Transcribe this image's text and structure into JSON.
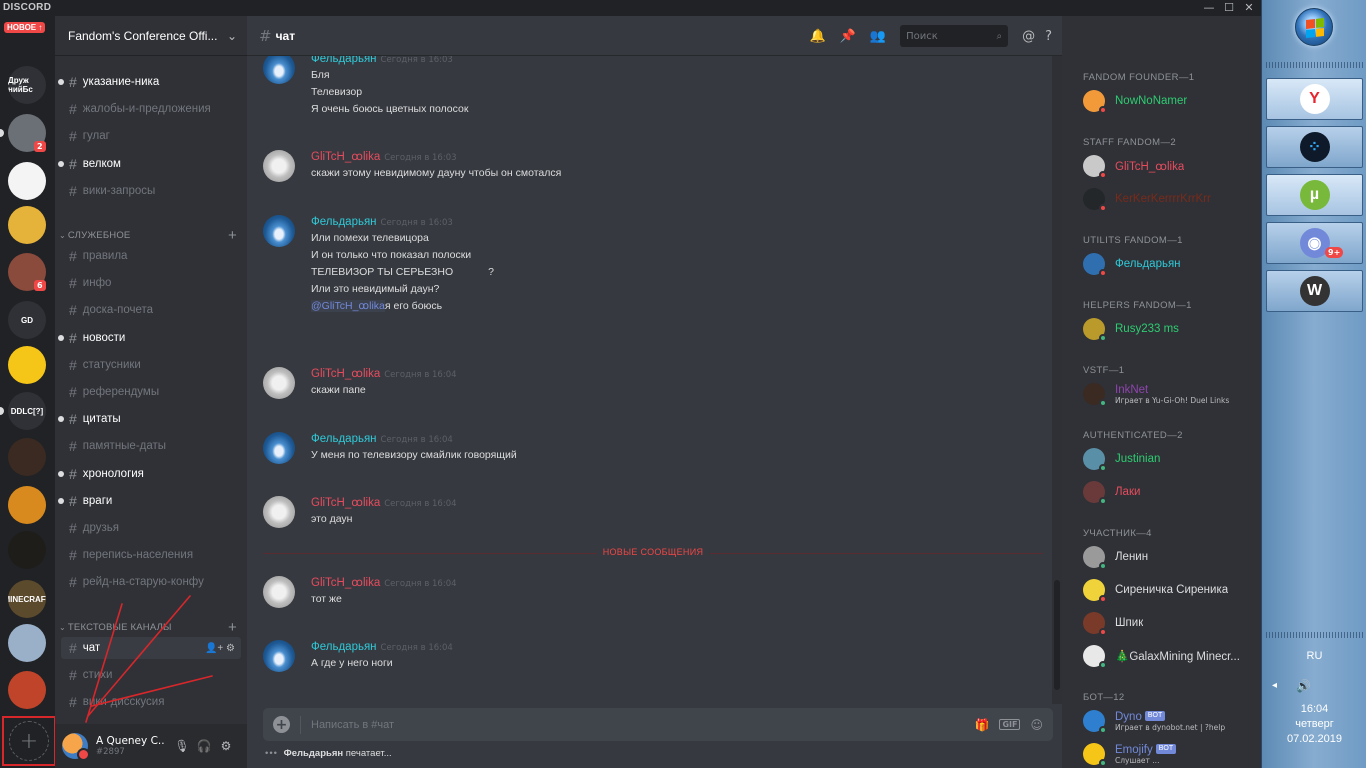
{
  "app": {
    "brand": "DISCORD",
    "window_controls": [
      "—",
      "☐",
      "✕"
    ]
  },
  "servers": {
    "new_badge": "НОВОЕ ↑",
    "items": [
      {
        "label": "Друж нийБс",
        "bg": "#2f3136",
        "badge": ""
      },
      {
        "label": "",
        "bg": "#6b6f76",
        "badge": "2"
      },
      {
        "label": "",
        "bg": "#f4f4f4",
        "badge": ""
      },
      {
        "label": "",
        "bg": "#e6b33a",
        "badge": ""
      },
      {
        "label": "",
        "bg": "#8a4a3c",
        "badge": "6"
      },
      {
        "label": "GD",
        "bg": "#2f3136",
        "badge": ""
      },
      {
        "label": "",
        "bg": "#f5c518",
        "badge": ""
      },
      {
        "label": "DDLC[?]",
        "bg": "#2f3136",
        "badge": ""
      },
      {
        "label": "",
        "bg": "#3b2a22",
        "badge": ""
      },
      {
        "label": "",
        "bg": "#d98a1e",
        "badge": ""
      },
      {
        "label": "",
        "bg": "#1e1d1a",
        "badge": ""
      },
      {
        "label": "MINECRAFT",
        "bg": "#5c4a2c",
        "badge": ""
      },
      {
        "label": "",
        "bg": "#9ab0c9",
        "badge": ""
      },
      {
        "label": "",
        "bg": "#c0442a",
        "badge": ""
      }
    ]
  },
  "guild": {
    "name": "Fandom's Conference Offi..."
  },
  "channels": {
    "list1": [
      {
        "name": "указание-ника",
        "unread": true
      },
      {
        "name": "жалобы-и-предложения",
        "unread": false
      },
      {
        "name": "гулаг",
        "unread": false
      },
      {
        "name": "велком",
        "unread": true
      },
      {
        "name": "вики-запросы",
        "unread": false
      }
    ],
    "cat_service": "СЛУЖЕБНОЕ",
    "list2": [
      {
        "name": "правила",
        "unread": false
      },
      {
        "name": "инфо",
        "unread": false
      },
      {
        "name": "доска-почета",
        "unread": false
      },
      {
        "name": "новости",
        "unread": true
      },
      {
        "name": "статусники",
        "unread": false
      },
      {
        "name": "референдумы",
        "unread": false
      },
      {
        "name": "цитаты",
        "unread": true
      },
      {
        "name": "памятные-даты",
        "unread": false
      },
      {
        "name": "хронология",
        "unread": true
      },
      {
        "name": "враги",
        "unread": true
      },
      {
        "name": "друзья",
        "unread": false
      },
      {
        "name": "перепись-населения",
        "unread": false
      },
      {
        "name": "рейд-на-старую-конфу",
        "unread": false
      }
    ],
    "cat_text": "ТЕКСТОВЫЕ КАНАЛЫ",
    "list3": [
      {
        "name": "чат",
        "active": true
      },
      {
        "name": "стихи",
        "active": false
      },
      {
        "name": "вики-дисскусия",
        "active": false
      }
    ]
  },
  "user": {
    "name": "A Queney C...",
    "discriminator": "#2897"
  },
  "chat": {
    "channel": "чат",
    "search_placeholder": "Поиск",
    "composer_placeholder": "Написать в #чат",
    "typing_user": "Фельдарьян",
    "typing_text": "печатает...",
    "new_messages_label": "НОВЫЕ СООБЩЕНИЯ",
    "messages": [
      {
        "author": "Фельдарьян",
        "kind": "f",
        "time": "Сегодня в 16:03",
        "lines": [
          "Бля",
          "Телевизор",
          "Я очень боюсь цветных полосок"
        ]
      },
      {
        "author": "GliTcH_ꝏlika",
        "kind": "g",
        "time": "Сегодня в 16:03",
        "lines": [
          "скажи этому невидимому дауну чтобы он смотался"
        ]
      },
      {
        "author": "Фельдарьян",
        "kind": "f",
        "time": "Сегодня в 16:03",
        "lines": [
          "Или помехи телевицора",
          "И он только что показал полоски",
          "",
          "ТЕЛЕВИЗОР ТЫ СЕРЬЕЗНО            ?",
          "Или это невидимый даун?"
        ],
        "mention": "@GliTcH_ꝏlika",
        "mention_tail": "я его боюсь"
      },
      {
        "author": "GliTcH_ꝏlika",
        "kind": "g",
        "time": "Сегодня в 16:04",
        "lines": [
          "скажи папе"
        ]
      },
      {
        "author": "Фельдарьян",
        "kind": "f",
        "time": "Сегодня в 16:04",
        "lines": [
          "У меня по телевизору смайлик говорящий"
        ]
      },
      {
        "author": "GliTcH_ꝏlika",
        "kind": "g",
        "time": "Сегодня в 16:04",
        "lines": [
          "это даун"
        ]
      },
      {
        "author": "GliTcH_ꝏlika",
        "kind": "g",
        "time": "Сегодня в 16:04",
        "lines": [
          "тот же"
        ]
      },
      {
        "author": "Фельдарьян",
        "kind": "f",
        "time": "Сегодня в 16:04",
        "lines": [
          "А где у него ноги"
        ]
      }
    ]
  },
  "members": {
    "roles": [
      {
        "title": "FANDOM FOUNDER—1",
        "members": [
          {
            "name": "NowNoNamer",
            "color": "#2ecc71",
            "status": "dnd",
            "av": "#f29a3a",
            "activity": ""
          }
        ]
      },
      {
        "title": "STAFF FANDOM—2",
        "members": [
          {
            "name": "GliTcH_ꝏlika",
            "color": "#e74c5e",
            "status": "dnd",
            "av": "#c9c9c9",
            "activity": ""
          },
          {
            "name": "KerKerKerrrrKrrKrr",
            "color": "#7a2a1a",
            "status": "dnd",
            "av": "#23272a",
            "activity": ""
          }
        ]
      },
      {
        "title": "UTILITS FANDOM—1",
        "members": [
          {
            "name": "Фельдарьян",
            "color": "#30c9d8",
            "status": "dnd",
            "av": "#2f6fb0",
            "activity": ""
          }
        ]
      },
      {
        "title": "HELPERS FANDOM—1",
        "members": [
          {
            "name": "Rusy233 ms",
            "color": "#2ecc71",
            "status": "on",
            "av": "#b99a2a",
            "activity": ""
          }
        ]
      },
      {
        "title": "VSTF—1",
        "members": [
          {
            "name": "InkNet",
            "color": "#8e44ad",
            "status": "on",
            "av": "#3a2a22",
            "activity": "Играет в Yu-Gi-Oh! Duel Links"
          }
        ]
      },
      {
        "title": "AUTHENTICATED—2",
        "members": [
          {
            "name": "Justinian",
            "color": "#2ecc71",
            "status": "on",
            "av": "#5a8fa8",
            "activity": ""
          },
          {
            "name": "Лаки",
            "color": "#e74c5e",
            "status": "on",
            "av": "#6a3a3a",
            "activity": ""
          }
        ]
      },
      {
        "title": "УЧАСТНИК—4",
        "members": [
          {
            "name": "Ленин",
            "color": "#dcddde",
            "status": "on",
            "av": "#9a9a9a",
            "activity": ""
          },
          {
            "name": "Сиреничка Сиреника",
            "color": "#dcddde",
            "status": "dnd",
            "av": "#f0d23a",
            "activity": ""
          },
          {
            "name": "Шпик",
            "color": "#dcddde",
            "status": "dnd",
            "av": "#7a3a2a",
            "activity": ""
          },
          {
            "name": "🎄GalaxMining Minecr...",
            "color": "#dcddde",
            "status": "on",
            "av": "#e8e8e8",
            "activity": ""
          }
        ]
      },
      {
        "title": "БОТ—12",
        "members": [
          {
            "name": "Dyno",
            "color": "#7289da",
            "status": "on",
            "av": "#2f7fd0",
            "activity": "Играет в dynobot.net | ?help",
            "bot": "BOT"
          },
          {
            "name": "Emojify",
            "color": "#7289da",
            "status": "on",
            "av": "#f5c518",
            "activity": "Слушает ...",
            "bot": "BOT"
          }
        ]
      }
    ]
  },
  "taskbar": {
    "apps": [
      {
        "name": "yandex-browser",
        "glyph": "Y",
        "bg": "#fff",
        "fg": "#e8242e",
        "badge": ""
      },
      {
        "name": "dots-app",
        "glyph": "⁘",
        "bg": "#0e1a2a",
        "fg": "#2fa8f0",
        "badge": ""
      },
      {
        "name": "utorrent",
        "glyph": "µ",
        "bg": "#78b83a",
        "fg": "#fff",
        "badge": ""
      },
      {
        "name": "discord",
        "glyph": "◉",
        "bg": "#7289da",
        "fg": "#fff",
        "badge": "9+"
      },
      {
        "name": "w-app",
        "glyph": "W",
        "bg": "#333",
        "fg": "#fff",
        "badge": ""
      }
    ],
    "lang": "RU",
    "time": "16:04",
    "weekday": "четверг",
    "date": "07.02.2019"
  }
}
